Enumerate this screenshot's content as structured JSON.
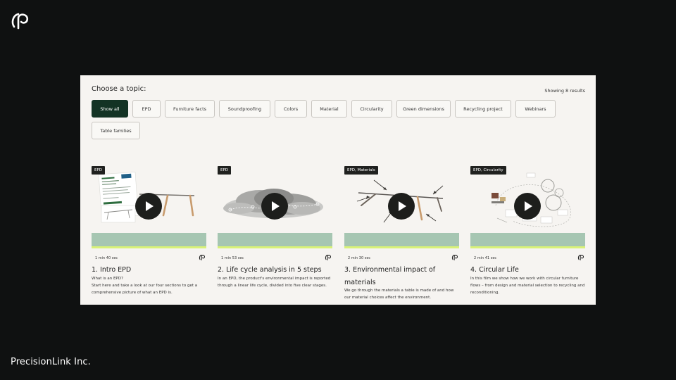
{
  "brand": {
    "logo_icon": "precisionlink-logo-icon"
  },
  "company": "PrecisionLink Inc.",
  "panel": {
    "choose_label": "Choose a topic:",
    "results_text": "Showing 8 results",
    "chips": [
      {
        "label": "Show all",
        "active": true
      },
      {
        "label": "EPD"
      },
      {
        "label": "Furniture facts"
      },
      {
        "label": "Soundproofing"
      },
      {
        "label": "Colors"
      },
      {
        "label": "Material"
      },
      {
        "label": "Circularity"
      },
      {
        "label": "Green dimensions"
      },
      {
        "label": "Recycling project"
      },
      {
        "label": "Webinars"
      },
      {
        "label": "Table families"
      }
    ],
    "cards": [
      {
        "tag": "EPD",
        "duration": "1 min 40 sec",
        "title_lines": [
          "1. Intro EPD"
        ],
        "desc_lines": [
          "What is an EPD?",
          "Start here and take a look at our four sections to get a",
          "comprehensive picture of what an EPD is."
        ]
      },
      {
        "tag": "EPD",
        "duration": "1 min 53 sec",
        "title_lines": [
          "2. Life cycle analysis in 5 steps"
        ],
        "desc_lines": [
          "In an EPD, the product's environmental impact is reported",
          "through a linear life cycle, divided into five clear stages."
        ]
      },
      {
        "tag": "EPD, Materials",
        "duration": "2 min 30 sec",
        "title_lines": [
          "3. Environmental impact of",
          "materials"
        ],
        "desc_lines": [
          "We go through the materials a table is made of and how",
          "our material choices affect the environment."
        ]
      },
      {
        "tag": "EPD, Circularity",
        "duration": "2 min 41 sec",
        "title_lines": [
          "4. Circular Life"
        ],
        "desc_lines": [
          "In this film we show how we work with circular furniture",
          "flows – from design and material selection to recycling and",
          "reconditioning."
        ]
      }
    ]
  },
  "colors": {
    "background": "#0f1111",
    "panel": "#f6f4f1",
    "chip_active": "#133324",
    "card_bar": "#a6c6b2",
    "card_bar_accent": "#d9f278",
    "play_button": "#1d1e1c"
  }
}
